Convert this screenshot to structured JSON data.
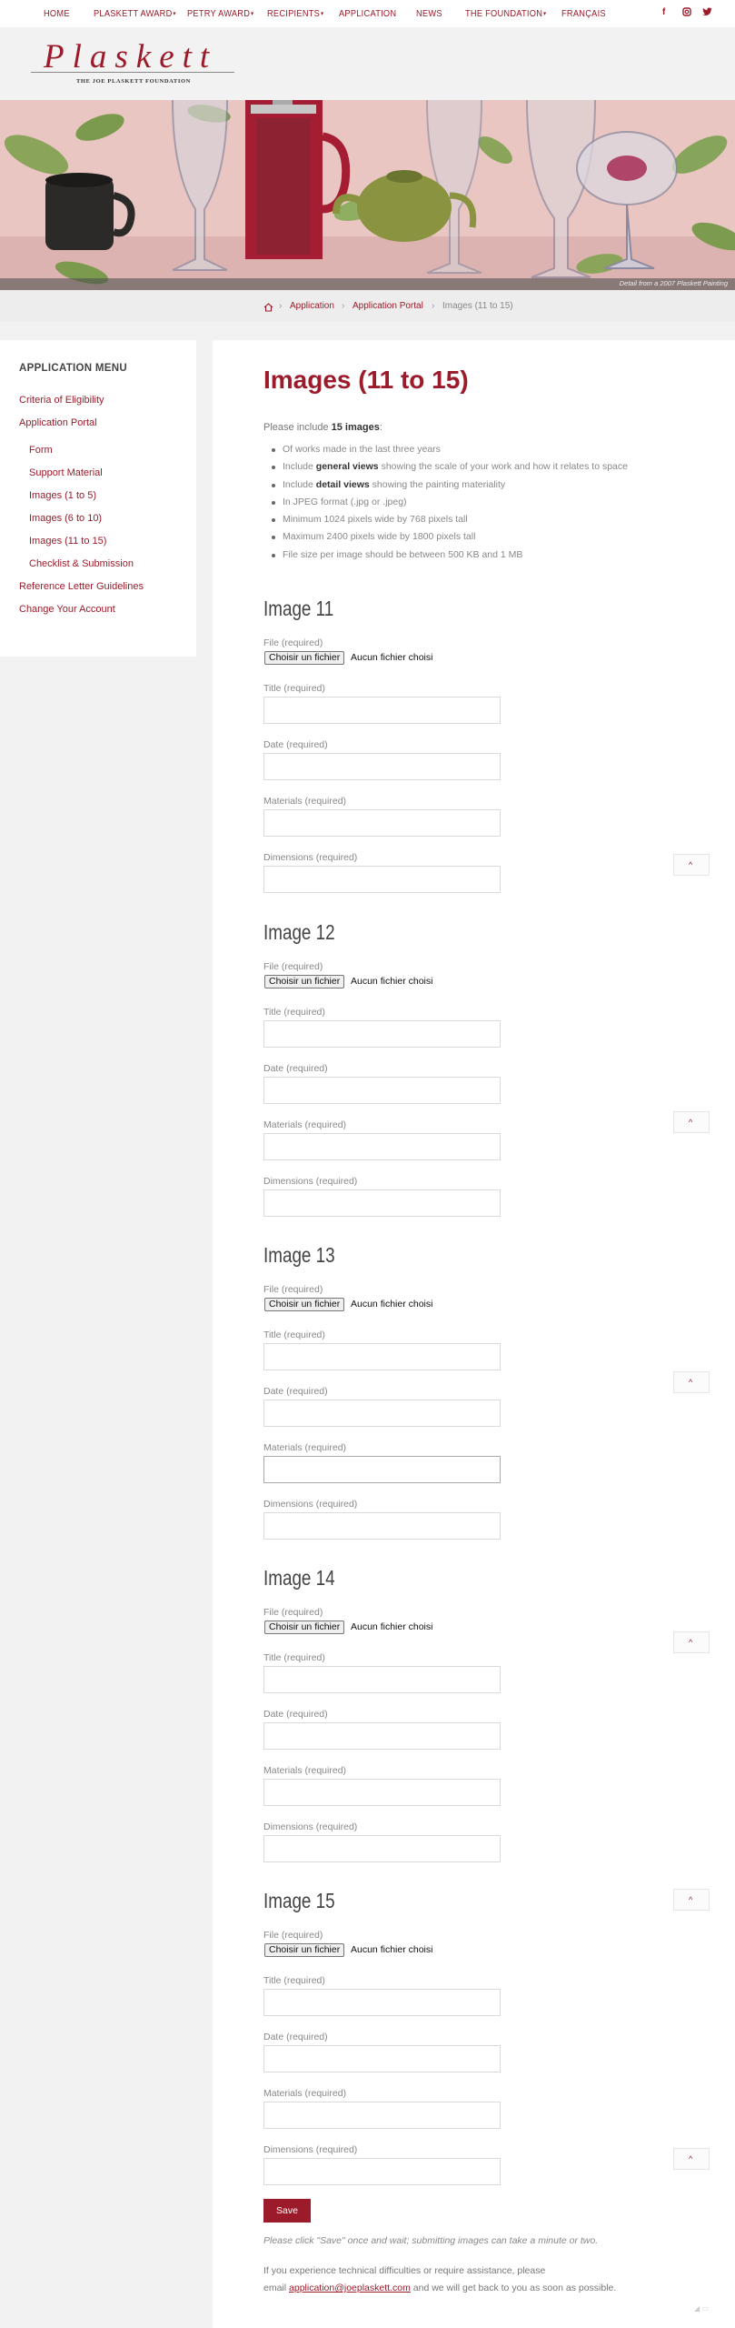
{
  "nav": {
    "items": [
      "HOME",
      "PLASKETT AWARD",
      "PETRY AWARD",
      "RECIPIENTS",
      "APPLICATION",
      "NEWS",
      "THE FOUNDATION",
      "FRANÇAIS"
    ],
    "social": [
      "f",
      "◎",
      "🐦"
    ]
  },
  "logo": {
    "name": "Plaskett",
    "subtitle": "THE JOE PLASKETT FOUNDATION"
  },
  "banner": {
    "caption": "Detail from a 2007 Plaskett Painting"
  },
  "breadcrumb": [
    "Application",
    "Application Portal",
    "Images (11 to 15)"
  ],
  "sidebar": {
    "title": "APPLICATION MENU",
    "items": [
      "Criteria of Eligibility",
      "Application Portal",
      "Form",
      "Support Material",
      "Images (1 to 5)",
      "Images (6 to 10)",
      "Images (11 to 15)",
      "Checklist & Submission",
      "Reference Letter Guidelines",
      "Change Your Account"
    ]
  },
  "main": {
    "title": "Images (11 to 15)",
    "intro_pre": "Please include ",
    "intro_bold": "15 images",
    "intro_post": ":",
    "bullets": [
      {
        "pre": "Of works made in the last three years",
        "bold": "",
        "post": ""
      },
      {
        "pre": "Include ",
        "bold": "general views",
        "post": " showing the scale of your work and how it relates to space"
      },
      {
        "pre": "Include ",
        "bold": "detail views",
        "post": " showing the painting materiality"
      },
      {
        "pre": "In JPEG format (.jpg or .jpeg)",
        "bold": "",
        "post": ""
      },
      {
        "pre": "Minimum 1024 pixels wide by 768 pixels tall",
        "bold": "",
        "post": ""
      },
      {
        "pre": "Maximum 2400 pixels wide by 1800 pixels tall",
        "bold": "",
        "post": ""
      },
      {
        "pre": "File size per image should be between 500 KB and 1 MB",
        "bold": "",
        "post": ""
      }
    ],
    "labels": {
      "file": "File (required)",
      "choose": "Choisir un fichier",
      "nofile": "Aucun fichier choisi",
      "title": "Title (required)",
      "date": "Date (required)",
      "materials": "Materials (required)",
      "dimensions": "Dimensions (required)"
    },
    "images": [
      "Image 11",
      "Image 12",
      "Image 13",
      "Image 14",
      "Image 15"
    ],
    "save": "Save",
    "note": "Please click \"Save\" once and wait; submitting images can take a minute or two.",
    "contact_line1": "If you experience technical difficulties or require assistance, please",
    "contact_pre": "email ",
    "contact_email": "application@joeplaskett.com",
    "contact_post": " and we will get back to you as soon as possible."
  },
  "colors": {
    "accent": "#9b1b2a",
    "background": "#f2f2f2"
  }
}
